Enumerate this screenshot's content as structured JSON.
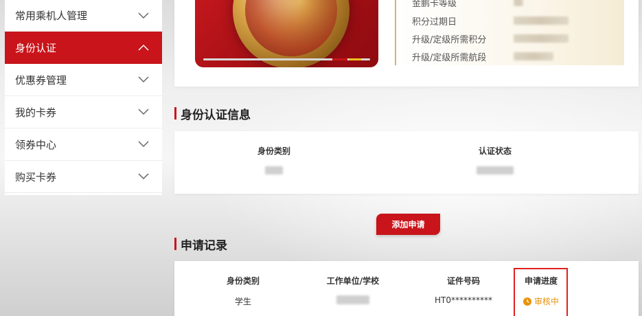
{
  "sidebar": {
    "items": [
      {
        "label": "常用乘机人管理",
        "active": false
      },
      {
        "label": "身份认证",
        "active": true
      },
      {
        "label": "优惠券管理",
        "active": false
      },
      {
        "label": "我的卡券",
        "active": false
      },
      {
        "label": "领券中心",
        "active": false
      },
      {
        "label": "购买卡券",
        "active": false
      }
    ]
  },
  "card_info": {
    "rows": [
      {
        "label": "金鹏卡等级"
      },
      {
        "label": "积分过期日"
      },
      {
        "label": "升级/定级所需积分"
      },
      {
        "label": "升级/定级所需航段"
      }
    ]
  },
  "identity_section": {
    "title": "身份认证信息",
    "col_type": "身份类别",
    "col_status": "认证状态"
  },
  "add_button": {
    "label": "添加申请"
  },
  "records_section": {
    "title": "申请记录",
    "headers": {
      "type": "身份类别",
      "org": "工作单位/学校",
      "id_no": "证件号码",
      "progress": "申请进度"
    },
    "row": {
      "type": "学生",
      "id_no": "HT0**********",
      "progress": "审核中"
    }
  },
  "colors": {
    "brand_red": "#c8141a",
    "status_orange": "#e8920c",
    "gold_border": "#d8b36a",
    "highlight_red": "#e02020"
  }
}
